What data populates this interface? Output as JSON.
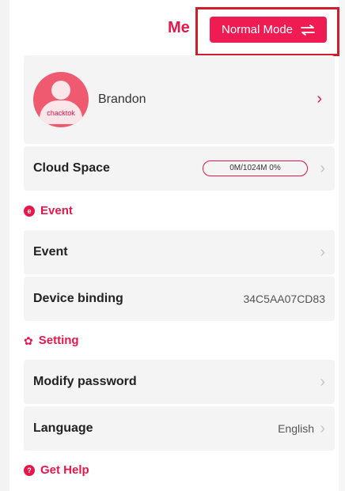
{
  "header": {
    "title": "Me",
    "mode_button_label": "Normal Mode"
  },
  "profile": {
    "username": "Brandon",
    "avatar_brand": "chacktok"
  },
  "cloud_space": {
    "label": "Cloud Space",
    "usage": "0M/1024M 0%",
    "usage_fraction": 0
  },
  "sections": {
    "event": {
      "title": "Event"
    },
    "setting": {
      "title": "Setting"
    },
    "help": {
      "title": "Get Help"
    }
  },
  "rows": {
    "event": {
      "label": "Event"
    },
    "device_binding": {
      "label": "Device binding",
      "value": "34C5AA07CD83"
    },
    "modify_password": {
      "label": "Modify password"
    },
    "language": {
      "label": "Language",
      "value": "English"
    }
  },
  "colors": {
    "accent": "#e8174a",
    "button": "#ef1c54",
    "card": "#f4f4f4"
  }
}
